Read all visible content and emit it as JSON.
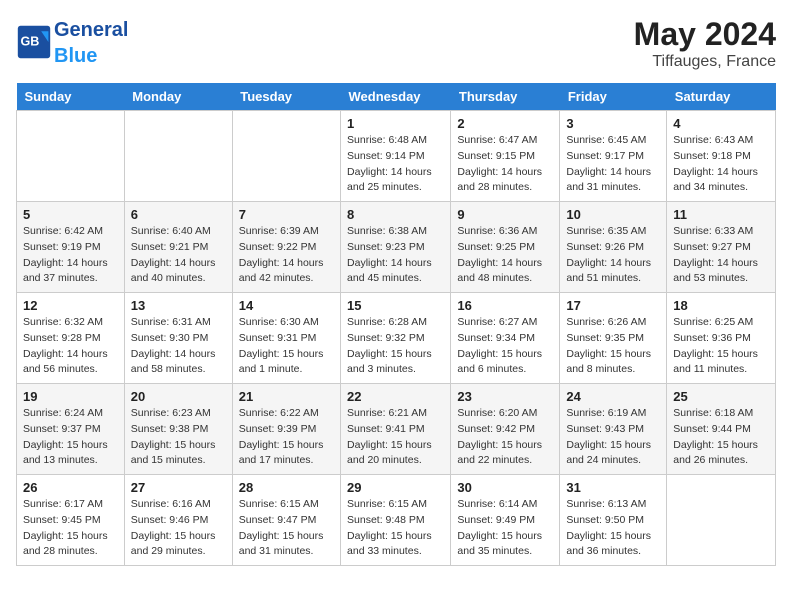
{
  "header": {
    "logo_general": "General",
    "logo_blue": "Blue",
    "month_year": "May 2024",
    "location": "Tiffauges, France"
  },
  "days_of_week": [
    "Sunday",
    "Monday",
    "Tuesday",
    "Wednesday",
    "Thursday",
    "Friday",
    "Saturday"
  ],
  "weeks": [
    [
      {
        "num": "",
        "sunrise": "",
        "sunset": "",
        "daylight": ""
      },
      {
        "num": "",
        "sunrise": "",
        "sunset": "",
        "daylight": ""
      },
      {
        "num": "",
        "sunrise": "",
        "sunset": "",
        "daylight": ""
      },
      {
        "num": "1",
        "sunrise": "Sunrise: 6:48 AM",
        "sunset": "Sunset: 9:14 PM",
        "daylight": "Daylight: 14 hours and 25 minutes."
      },
      {
        "num": "2",
        "sunrise": "Sunrise: 6:47 AM",
        "sunset": "Sunset: 9:15 PM",
        "daylight": "Daylight: 14 hours and 28 minutes."
      },
      {
        "num": "3",
        "sunrise": "Sunrise: 6:45 AM",
        "sunset": "Sunset: 9:17 PM",
        "daylight": "Daylight: 14 hours and 31 minutes."
      },
      {
        "num": "4",
        "sunrise": "Sunrise: 6:43 AM",
        "sunset": "Sunset: 9:18 PM",
        "daylight": "Daylight: 14 hours and 34 minutes."
      }
    ],
    [
      {
        "num": "5",
        "sunrise": "Sunrise: 6:42 AM",
        "sunset": "Sunset: 9:19 PM",
        "daylight": "Daylight: 14 hours and 37 minutes."
      },
      {
        "num": "6",
        "sunrise": "Sunrise: 6:40 AM",
        "sunset": "Sunset: 9:21 PM",
        "daylight": "Daylight: 14 hours and 40 minutes."
      },
      {
        "num": "7",
        "sunrise": "Sunrise: 6:39 AM",
        "sunset": "Sunset: 9:22 PM",
        "daylight": "Daylight: 14 hours and 42 minutes."
      },
      {
        "num": "8",
        "sunrise": "Sunrise: 6:38 AM",
        "sunset": "Sunset: 9:23 PM",
        "daylight": "Daylight: 14 hours and 45 minutes."
      },
      {
        "num": "9",
        "sunrise": "Sunrise: 6:36 AM",
        "sunset": "Sunset: 9:25 PM",
        "daylight": "Daylight: 14 hours and 48 minutes."
      },
      {
        "num": "10",
        "sunrise": "Sunrise: 6:35 AM",
        "sunset": "Sunset: 9:26 PM",
        "daylight": "Daylight: 14 hours and 51 minutes."
      },
      {
        "num": "11",
        "sunrise": "Sunrise: 6:33 AM",
        "sunset": "Sunset: 9:27 PM",
        "daylight": "Daylight: 14 hours and 53 minutes."
      }
    ],
    [
      {
        "num": "12",
        "sunrise": "Sunrise: 6:32 AM",
        "sunset": "Sunset: 9:28 PM",
        "daylight": "Daylight: 14 hours and 56 minutes."
      },
      {
        "num": "13",
        "sunrise": "Sunrise: 6:31 AM",
        "sunset": "Sunset: 9:30 PM",
        "daylight": "Daylight: 14 hours and 58 minutes."
      },
      {
        "num": "14",
        "sunrise": "Sunrise: 6:30 AM",
        "sunset": "Sunset: 9:31 PM",
        "daylight": "Daylight: 15 hours and 1 minute."
      },
      {
        "num": "15",
        "sunrise": "Sunrise: 6:28 AM",
        "sunset": "Sunset: 9:32 PM",
        "daylight": "Daylight: 15 hours and 3 minutes."
      },
      {
        "num": "16",
        "sunrise": "Sunrise: 6:27 AM",
        "sunset": "Sunset: 9:34 PM",
        "daylight": "Daylight: 15 hours and 6 minutes."
      },
      {
        "num": "17",
        "sunrise": "Sunrise: 6:26 AM",
        "sunset": "Sunset: 9:35 PM",
        "daylight": "Daylight: 15 hours and 8 minutes."
      },
      {
        "num": "18",
        "sunrise": "Sunrise: 6:25 AM",
        "sunset": "Sunset: 9:36 PM",
        "daylight": "Daylight: 15 hours and 11 minutes."
      }
    ],
    [
      {
        "num": "19",
        "sunrise": "Sunrise: 6:24 AM",
        "sunset": "Sunset: 9:37 PM",
        "daylight": "Daylight: 15 hours and 13 minutes."
      },
      {
        "num": "20",
        "sunrise": "Sunrise: 6:23 AM",
        "sunset": "Sunset: 9:38 PM",
        "daylight": "Daylight: 15 hours and 15 minutes."
      },
      {
        "num": "21",
        "sunrise": "Sunrise: 6:22 AM",
        "sunset": "Sunset: 9:39 PM",
        "daylight": "Daylight: 15 hours and 17 minutes."
      },
      {
        "num": "22",
        "sunrise": "Sunrise: 6:21 AM",
        "sunset": "Sunset: 9:41 PM",
        "daylight": "Daylight: 15 hours and 20 minutes."
      },
      {
        "num": "23",
        "sunrise": "Sunrise: 6:20 AM",
        "sunset": "Sunset: 9:42 PM",
        "daylight": "Daylight: 15 hours and 22 minutes."
      },
      {
        "num": "24",
        "sunrise": "Sunrise: 6:19 AM",
        "sunset": "Sunset: 9:43 PM",
        "daylight": "Daylight: 15 hours and 24 minutes."
      },
      {
        "num": "25",
        "sunrise": "Sunrise: 6:18 AM",
        "sunset": "Sunset: 9:44 PM",
        "daylight": "Daylight: 15 hours and 26 minutes."
      }
    ],
    [
      {
        "num": "26",
        "sunrise": "Sunrise: 6:17 AM",
        "sunset": "Sunset: 9:45 PM",
        "daylight": "Daylight: 15 hours and 28 minutes."
      },
      {
        "num": "27",
        "sunrise": "Sunrise: 6:16 AM",
        "sunset": "Sunset: 9:46 PM",
        "daylight": "Daylight: 15 hours and 29 minutes."
      },
      {
        "num": "28",
        "sunrise": "Sunrise: 6:15 AM",
        "sunset": "Sunset: 9:47 PM",
        "daylight": "Daylight: 15 hours and 31 minutes."
      },
      {
        "num": "29",
        "sunrise": "Sunrise: 6:15 AM",
        "sunset": "Sunset: 9:48 PM",
        "daylight": "Daylight: 15 hours and 33 minutes."
      },
      {
        "num": "30",
        "sunrise": "Sunrise: 6:14 AM",
        "sunset": "Sunset: 9:49 PM",
        "daylight": "Daylight: 15 hours and 35 minutes."
      },
      {
        "num": "31",
        "sunrise": "Sunrise: 6:13 AM",
        "sunset": "Sunset: 9:50 PM",
        "daylight": "Daylight: 15 hours and 36 minutes."
      },
      {
        "num": "",
        "sunrise": "",
        "sunset": "",
        "daylight": ""
      }
    ]
  ]
}
